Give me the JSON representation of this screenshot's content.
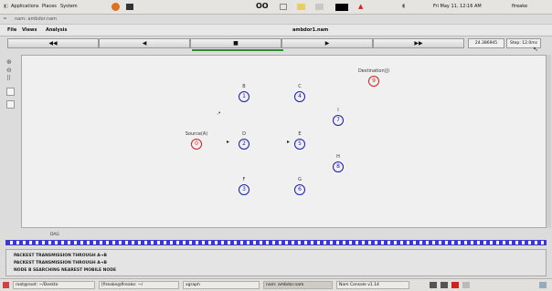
{
  "top_panel": {
    "menus": [
      "Applications",
      "Places",
      "System"
    ],
    "center_glyph": "OO",
    "clock": "Fri May 11, 12:16 AM",
    "user": "fireake"
  },
  "window": {
    "title": "nam: ambdor.nam"
  },
  "menubar": {
    "items": [
      "File",
      "Views",
      "Analysis"
    ],
    "file_name": "ambdor1.nam"
  },
  "toolbar": {
    "rewind": "◀◀",
    "back": "◀",
    "stop": "■",
    "play": "▶",
    "forward": "▶▶",
    "time": "24.386945",
    "step": "Step: 12.0ms"
  },
  "nodes": [
    {
      "id": "0",
      "label": "Source(A)"
    },
    {
      "id": "1",
      "label": "B"
    },
    {
      "id": "2",
      "label": "D"
    },
    {
      "id": "3",
      "label": "F"
    },
    {
      "id": "4",
      "label": "C"
    },
    {
      "id": "5",
      "label": "E"
    },
    {
      "id": "6",
      "label": "G"
    },
    {
      "id": "7",
      "label": "I"
    },
    {
      "id": "8",
      "label": "H"
    },
    {
      "id": "9",
      "label": "Destination(J)"
    }
  ],
  "timeline": {
    "label": "DAG"
  },
  "log": {
    "lines": [
      "PACKEST TRANSMISSION THROUGH A→B",
      "PACKEST TRANSMISSION THROUGH A→B",
      "NODE B SEARCHING NEAREST MOBILE NODE"
    ]
  },
  "taskbar": {
    "items": [
      "root@root: ~/Deskto",
      "[fireake@fireake: ~/",
      "xgraph",
      "nam: ambdor.nam",
      "Nam Console v1.14"
    ]
  },
  "colors": {
    "node_blue": "#1c1cb0",
    "node_red": "#d02020",
    "progress_green": "#2e8b2e",
    "timeline_blue": "#3a3ad0"
  }
}
